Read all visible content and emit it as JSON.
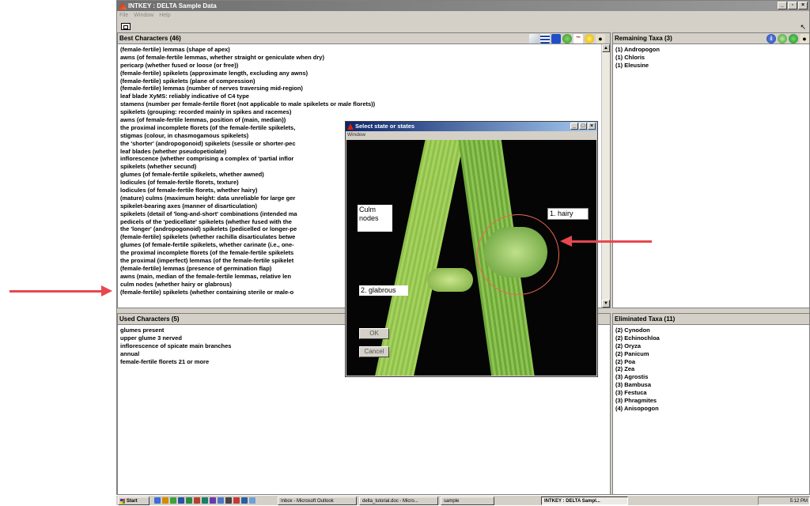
{
  "window": {
    "title": "INTKEY : DELTA Sample Data",
    "controls": [
      "_",
      "̅̅",
      "×"
    ]
  },
  "menubar": {
    "items": [
      "File",
      "Window",
      "Help"
    ]
  },
  "best_characters": {
    "header": "Best Characters (46)",
    "items": [
      "(female-fertile) lemmas (shape of apex)",
      "awns (of female-fertile lemmas, whether straight or geniculate when dry)",
      "pericarp (whether fused or loose (or free))",
      "(female-fertile) spikelets (approximate length, excluding any awns)",
      "(female-fertile) spikelets (plane of compression)",
      "(female-fertile) lemmas (number of nerves traversing mid-region)",
      "leaf blade XyMS: reliably indicative of C4 type",
      "stamens (number per female-fertile floret (not applicable to male spikelets or male florets))",
      "spikelets (grouping: recorded mainly in spikes and racemes)",
      "awns (of female-fertile lemmas, position of (main, median))",
      "the proximal incomplete florets (of the female-fertile spikelets,",
      "stigmas (colour, in chasmogamous spikelets)",
      "the 'shorter' (andropogonoid) spikelets (sessile or shorter-pec",
      "leaf blades (whether pseudopetiolate)",
      "inflorescence (whether comprising a complex of 'partial inflor",
      "spikelets (whether secund)",
      "glumes (of female-fertile spikelets, whether awned)",
      "lodicules (of female-fertile florets, texture)",
      "lodicules (of female-fertile florets, whether hairy)",
      "(mature) culms (maximum height: data unreliable for large ger",
      "spikelet-bearing axes (manner of disarticulation)",
      "spikelets (detail of 'long-and-short' combinations (intended ma",
      "pedicels of the 'pedicellate' spikelets (whether fused with the",
      "the 'longer' (andropogonoid) spikelets (pedicelled or longer-pe",
      "(female-fertile) spikelets (whether rachilla disarticulates betwe",
      "glumes (of female-fertile spikelets, whether carinate (i.e., one-",
      "the proximal incomplete florets (of the female-fertile spikelets",
      "the proximal (imperfect) lemmas (of the female-fertile spikelet",
      "(female-fertile) lemmas (presence of germination flap)",
      "awns (main, median of the female-fertile lemmas, relative len",
      "culm nodes (whether hairy or glabrous)",
      "(female-fertile) spikelets (whether containing sterile or male-o"
    ]
  },
  "used_characters": {
    "header": "Used Characters (5)",
    "items": [
      "glumes present",
      "upper glume 3 nerved",
      "inflorescence of spicate main branches",
      "annual",
      "female-fertile florets 21 or more"
    ]
  },
  "remaining_taxa": {
    "header": "Remaining Taxa (3)",
    "items": [
      "(1)  Andropogon",
      "(1)  Chloris",
      "(1)  Eleusine"
    ]
  },
  "eliminated_taxa": {
    "header": "Eliminated Taxa (11)",
    "items": [
      "(2)  Cynodon",
      "(2)  Echinochloa",
      "(2)  Oryza",
      "(2)  Panicum",
      "(2)  Poa",
      "(2)  Zea",
      "(3)  Agrostis",
      "(3)  Bambusa",
      "(3)  Festuca",
      "(3)  Phragmites",
      "(4)  Anisopogon"
    ]
  },
  "dialog": {
    "title": "Select state or states",
    "menu": "Window",
    "culm_label": "Culm\nnodes",
    "state_hairy": "1. hairy",
    "state_glabrous": "2. glabrous",
    "ok": "OK",
    "cancel": "Cancel"
  },
  "taskbar": {
    "start": "Start",
    "tasks": [
      "Inbox - Microsoft Outlook",
      "delta_tutorial.doc - Micro...",
      "sample",
      "INTKEY : DELTA Sampl..."
    ],
    "clock": "5:12 PM"
  },
  "colors": {
    "arrow": "#e8474f",
    "highlight_circle": "#ee6655",
    "titlebar_dialog": "#0a246a"
  }
}
